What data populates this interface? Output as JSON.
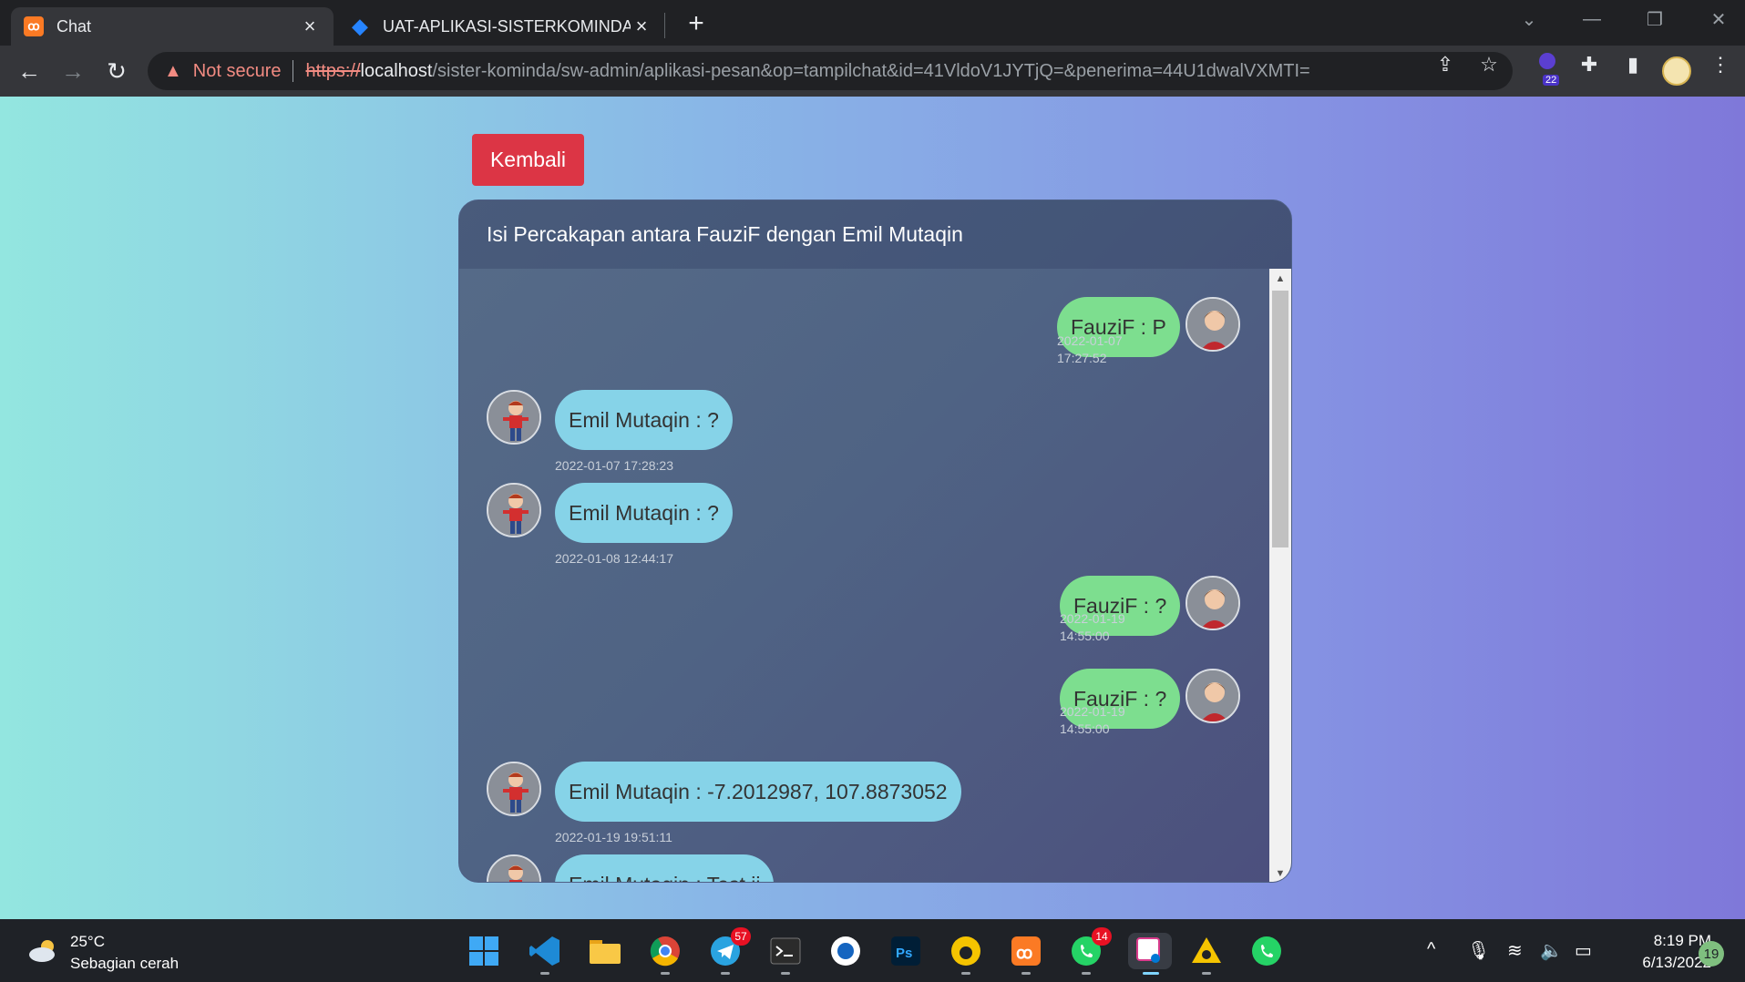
{
  "browser": {
    "tabs": [
      {
        "title": "Chat",
        "favicon": "xampp-icon",
        "active": true
      },
      {
        "title": "UAT-APLIKASI-SISTERKOMINDA-",
        "favicon": "jira-icon",
        "active": false
      }
    ],
    "address": {
      "security_label": "Not secure",
      "scheme": "https://",
      "host": "localhost",
      "path": "/sister-kominda/sw-admin/aplikasi-pesan&op=tampilchat&id=41VldoV1JYTjQ=&penerima=44U1dwalVXMTI="
    },
    "extension_badge": "22"
  },
  "page": {
    "back_button_label": "Kembali",
    "chat_title": "Isi Percakapan antara FauziF dengan Emil Mutaqin",
    "messages": [
      {
        "side": "right",
        "text": "FauziF : P",
        "date": "2022-01-07",
        "time": "17:27:52"
      },
      {
        "side": "left",
        "text": "Emil Mutaqin : ?",
        "timestamp": "2022-01-07 17:28:23"
      },
      {
        "side": "left",
        "text": "Emil Mutaqin : ?",
        "timestamp": "2022-01-08 12:44:17"
      },
      {
        "side": "right",
        "text": "FauziF : ?",
        "date": "2022-01-19",
        "time": "14:55:00"
      },
      {
        "side": "right",
        "text": "FauziF : ?",
        "date": "2022-01-19",
        "time": "14:55:00"
      },
      {
        "side": "left",
        "text": "Emil Mutaqin : -7.2012987, 107.8873052",
        "timestamp": "2022-01-19 19:51:11"
      },
      {
        "side": "left",
        "text": "Emil Mutaqin : Test ii",
        "timestamp": ""
      }
    ],
    "colors": {
      "sender_bubble": "#7dde8f",
      "receiver_bubble": "#86d3e8",
      "back_button": "#dc3545"
    }
  },
  "taskbar": {
    "weather_temp": "25°C",
    "weather_desc": "Sebagian cerah",
    "telegram_badge": "57",
    "whatsapp_badge": "14",
    "clock_time": "8:19 PM",
    "clock_date": "6/13/2022",
    "notification_count": "19"
  }
}
